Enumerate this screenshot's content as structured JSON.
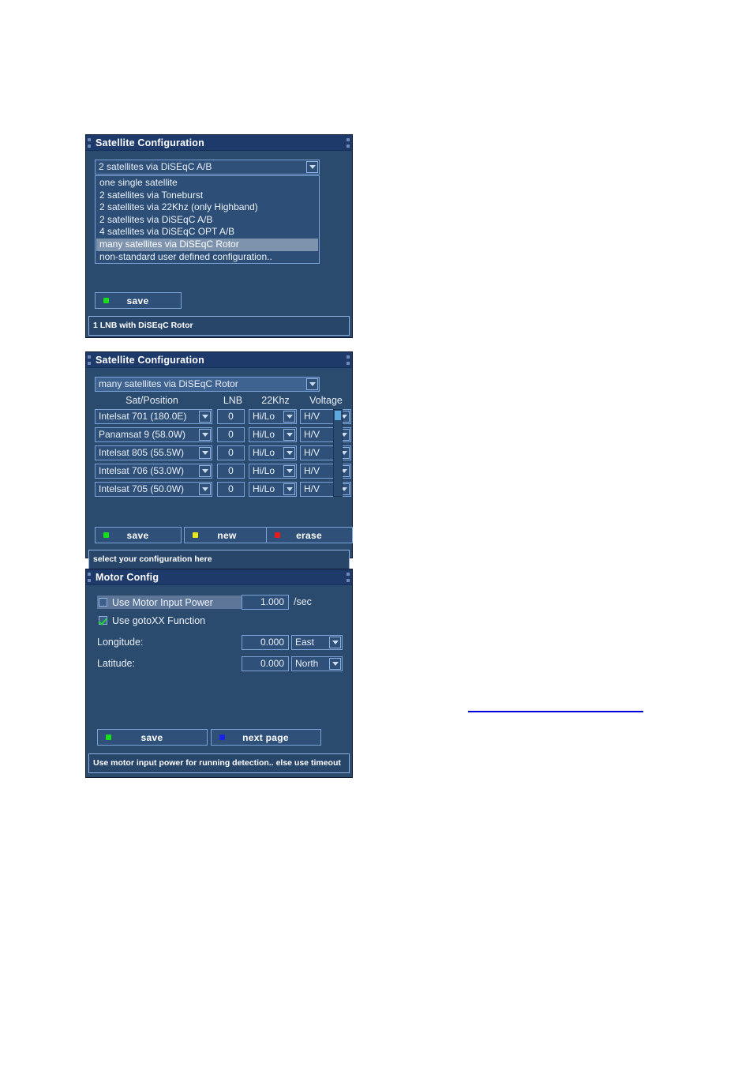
{
  "panel1": {
    "title": "Satellite Configuration",
    "combo_value": "2 satellites via DiSEqC A/B",
    "list_options": [
      "one single satellite",
      "2 satellites via Toneburst",
      "2 satellites via 22Khz (only Highband)",
      "2 satellites via DiSEqC A/B",
      "4 satellites via DiSEqC OPT A/B",
      "many satellites via DiSEqC Rotor",
      "non-standard user defined configuration.."
    ],
    "selected_index": 5,
    "save_label": "save",
    "save_led_color": "#17e018",
    "status_text": "1 LNB with DiSEqC Rotor"
  },
  "panel2": {
    "title": "Satellite Configuration",
    "combo_value": "many satellites via DiSEqC Rotor",
    "headers": [
      "Sat/Position",
      "LNB",
      "22Khz",
      "Voltage"
    ],
    "rows": [
      {
        "sat": "Intelsat 701 (180.0E)",
        "lnb": "0",
        "khz": "Hi/Lo",
        "voltage": "H/V"
      },
      {
        "sat": "Panamsat 9 (58.0W)",
        "lnb": "0",
        "khz": "Hi/Lo",
        "voltage": "H/V"
      },
      {
        "sat": "Intelsat 805 (55.5W)",
        "lnb": "0",
        "khz": "Hi/Lo",
        "voltage": "H/V"
      },
      {
        "sat": "Intelsat 706 (53.0W)",
        "lnb": "0",
        "khz": "Hi/Lo",
        "voltage": "H/V"
      },
      {
        "sat": "Intelsat 705 (50.0W)",
        "lnb": "0",
        "khz": "Hi/Lo",
        "voltage": "H/V"
      }
    ],
    "buttons": [
      {
        "label": "save",
        "led": "#17e018"
      },
      {
        "label": "new",
        "led": "#e8e81c"
      },
      {
        "label": "erase",
        "led": "#e81c1c"
      }
    ],
    "status_text": "select your configuration here"
  },
  "panel3": {
    "title": "Motor Config",
    "motor_power_label": "Use Motor Input Power",
    "motor_power_checked": false,
    "motor_power_value": "1.000",
    "motor_power_unit": "/sec",
    "gotoxx_label": "Use gotoXX Function",
    "gotoxx_checked": true,
    "longitude_label": "Longitude:",
    "longitude_value": "0.000",
    "longitude_dir": "East",
    "latitude_label": "Latitude:",
    "latitude_value": "0.000",
    "latitude_dir": "North",
    "buttons": [
      {
        "label": "save",
        "led": "#17e018"
      },
      {
        "label": "next page",
        "led": "#1a24e8"
      }
    ],
    "status_text": "Use motor input power for running detection.. else use timeout"
  },
  "link_rule": {
    "color": "#0000d8"
  }
}
